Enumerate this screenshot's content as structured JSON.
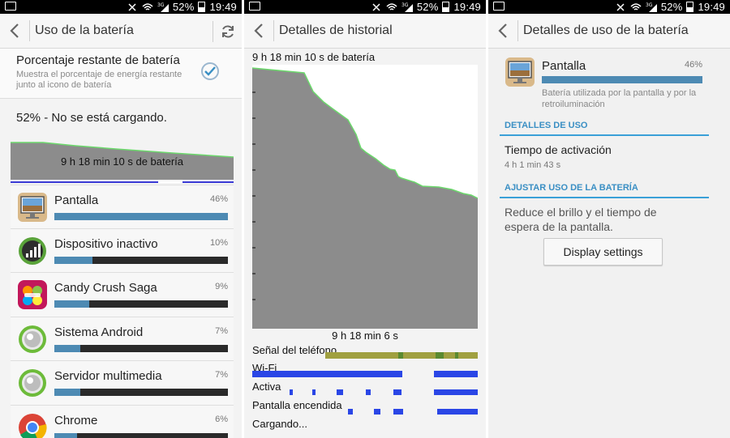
{
  "status_bar": {
    "battery_percent": "52%",
    "time": "19:49",
    "network": "3G"
  },
  "battery_usage": {
    "title": "Uso de la batería",
    "pref_title": "Porcentaje restante de batería",
    "pref_summary": "Muestra el porcentaje de energía restante junto al icono de batería",
    "pref_checked": true,
    "status": "52% - No se está cargando.",
    "graph_label": "9 h 18 min 10 s de batería",
    "apps": [
      {
        "name": "Pantalla",
        "percent": "46%",
        "value": 46,
        "icon": "screen-icon"
      },
      {
        "name": "Dispositivo inactivo",
        "percent": "10%",
        "value": 10,
        "icon": "signal-icon"
      },
      {
        "name": "Candy Crush Saga",
        "percent": "9%",
        "value": 9,
        "icon": "candy-icon"
      },
      {
        "name": "Sistema Android",
        "percent": "7%",
        "value": 7,
        "icon": "android-icon"
      },
      {
        "name": "Servidor multimedia",
        "percent": "7%",
        "value": 7,
        "icon": "android-icon"
      },
      {
        "name": "Chrome",
        "percent": "6%",
        "value": 6,
        "icon": "chrome-icon"
      }
    ]
  },
  "history": {
    "title": "Detalles de historial",
    "top_label": "9 h 18 min 10 s de batería",
    "bottom_label": "9 h 18 min 6 s",
    "tracks": [
      {
        "label": "Señal del teléfono"
      },
      {
        "label": "Wi-Fi"
      },
      {
        "label": "Activa"
      },
      {
        "label": "Pantalla encendida"
      },
      {
        "label": "Cargando..."
      }
    ]
  },
  "details": {
    "title": "Detalles de uso de la batería",
    "item_name": "Pantalla",
    "item_percent": "46%",
    "item_value": 46,
    "item_desc": "Batería utilizada por la pantalla y por la retroiluminación",
    "section_usage": "DETALLES DE USO",
    "active_time_label": "Tiempo de activación",
    "active_time_value": "4 h 1 min 43 s",
    "section_adjust": "AJUSTAR USO DE LA BATERÍA",
    "adjust_text": "Reduce el brillo y el tiempo de espera de la pantalla.",
    "button_label": "Display settings"
  },
  "colors": {
    "accent": "#3a8fc4",
    "bar": "#4d8ab3",
    "graph_fill": "#8c8c8c",
    "graph_line": "#6cd86c",
    "track_blue": "#2a46e6"
  }
}
